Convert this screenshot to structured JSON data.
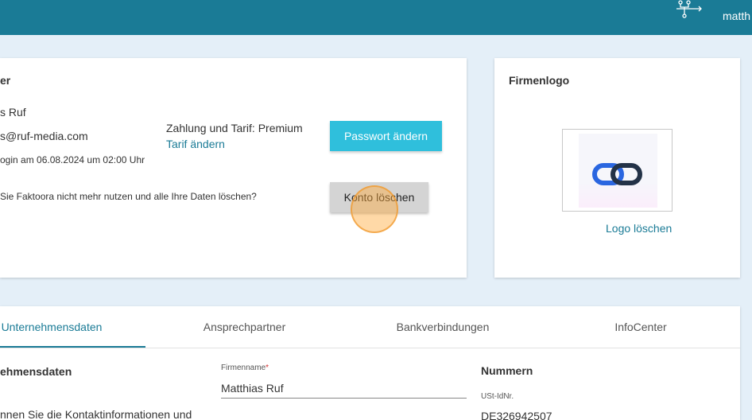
{
  "header": {
    "user_name": "matth",
    "org_icon": "org-structure-icon"
  },
  "account": {
    "title": "er",
    "name": "s Ruf",
    "email": "s@ruf-media.com",
    "last_login": "ogin am 06.08.2024 um 02:00 Uhr",
    "plan_text": "Zahlung und Tarif: Premium",
    "change_plan_link": "Tarif ändern",
    "change_password_button": "Passwort ändern",
    "delete_question": "Sie Faktoora nicht mehr nutzen und alle Ihre Daten löschen?",
    "delete_account_button": "Konto löschen"
  },
  "logo_card": {
    "title": "Firmenlogo",
    "logo_icon": "chain-link-logo",
    "delete_logo_link": "Logo löschen"
  },
  "tabs": [
    {
      "label": "Unternehmensdaten",
      "active": true
    },
    {
      "label": "Ansprechpartner",
      "active": false
    },
    {
      "label": "Bankverbindungen",
      "active": false
    },
    {
      "label": "InfoCenter",
      "active": false
    }
  ],
  "company_section": {
    "title": "ehmensdaten",
    "description": "nnen Sie die Kontaktinformationen und",
    "company_name_label": "Firmenname",
    "required_mark": "*",
    "company_name_value": "Matthias Ruf",
    "numbers_title": "Nummern",
    "vat_label": "USt-IdNr.",
    "vat_value": "DE326942507"
  },
  "colors": {
    "header_bg": "#1a7b96",
    "page_bg": "#e4eff8",
    "primary_button": "#2fbfdc",
    "link": "#1a7b96"
  }
}
